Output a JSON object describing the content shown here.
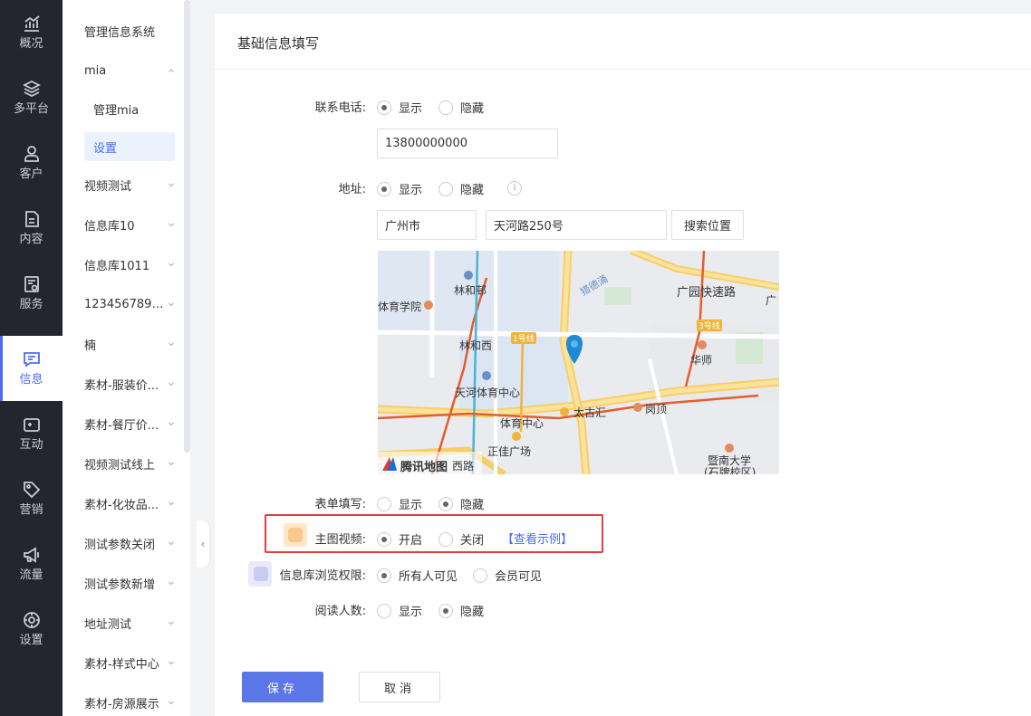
{
  "rail": {
    "items": [
      {
        "label": "概况",
        "icon": "chart-icon"
      },
      {
        "label": "多平台",
        "icon": "layers-icon"
      },
      {
        "label": "客户",
        "icon": "user-icon"
      },
      {
        "label": "内容",
        "icon": "document-icon"
      },
      {
        "label": "服务",
        "icon": "service-icon"
      },
      {
        "label": "信息",
        "icon": "message-icon"
      },
      {
        "label": "互动",
        "icon": "gamepad-icon"
      },
      {
        "label": "营销",
        "icon": "tag-icon"
      },
      {
        "label": "流量",
        "icon": "megaphone-icon"
      },
      {
        "label": "设置",
        "icon": "settings-icon"
      }
    ],
    "active": "信息",
    "accent_color": "#4a6cf7"
  },
  "submenu": {
    "items": [
      {
        "label": "管理信息系统"
      },
      {
        "label": "mia"
      },
      {
        "label": "管理mia"
      },
      {
        "label": "设置"
      },
      {
        "label": "视频测试"
      },
      {
        "label": "信息库10"
      },
      {
        "label": "信息库1011"
      },
      {
        "label": "1234567891..."
      },
      {
        "label": "楠"
      },
      {
        "label": "素材-服装价..."
      },
      {
        "label": "素材-餐厅价..."
      },
      {
        "label": "视频测试线上"
      },
      {
        "label": "素材-化妆品..."
      },
      {
        "label": "测试参数关闭"
      },
      {
        "label": "测试参数新增"
      },
      {
        "label": "地址测试"
      },
      {
        "label": "素材-样式中心"
      },
      {
        "label": "素材-房源展示"
      }
    ],
    "selected": "设置",
    "collapse_glyph": "‹"
  },
  "form": {
    "title": "基础信息填写",
    "phone": {
      "label": "联系电话:",
      "options": [
        "显示",
        "隐藏"
      ],
      "selected": "显示",
      "value": "13800000000"
    },
    "address": {
      "label": "地址:",
      "options": [
        "显示",
        "隐藏"
      ],
      "selected": "显示",
      "info_glyph": "i",
      "city": "广州市",
      "street": "天河路250号",
      "search_button": "搜索位置"
    },
    "map": {
      "labels": [
        "林和邨",
        "体育学院",
        "林和西",
        "1号线",
        "天河体育中心",
        "体育中心",
        "太古汇",
        "岗顶",
        "正佳广场",
        "华师",
        "3号线",
        "广园快速路",
        "猎德涌",
        "暨南大学",
        "(石牌校区)",
        "西路",
        "广"
      ],
      "brand": "腾讯地图"
    },
    "form_fill": {
      "label": "表单填写:",
      "options": [
        "显示",
        "隐藏"
      ],
      "selected": "隐藏"
    },
    "main_video": {
      "label": "主图视频:",
      "options": [
        "开启",
        "关闭"
      ],
      "selected": "开启",
      "example_link": "【查看示例】"
    },
    "browse_permission": {
      "label": "信息库浏览权限:",
      "options": [
        "所有人可见",
        "会员可见"
      ],
      "selected": "所有人可见"
    },
    "read_count": {
      "label": "阅读人数:",
      "options": [
        "显示",
        "隐藏"
      ],
      "selected": "隐藏"
    }
  },
  "actions": {
    "save": "保存",
    "cancel": "取消"
  },
  "colors": {
    "primary_button": "#5b76e6",
    "highlight_border": "#e43d3d",
    "rail_background": "#23262e"
  }
}
